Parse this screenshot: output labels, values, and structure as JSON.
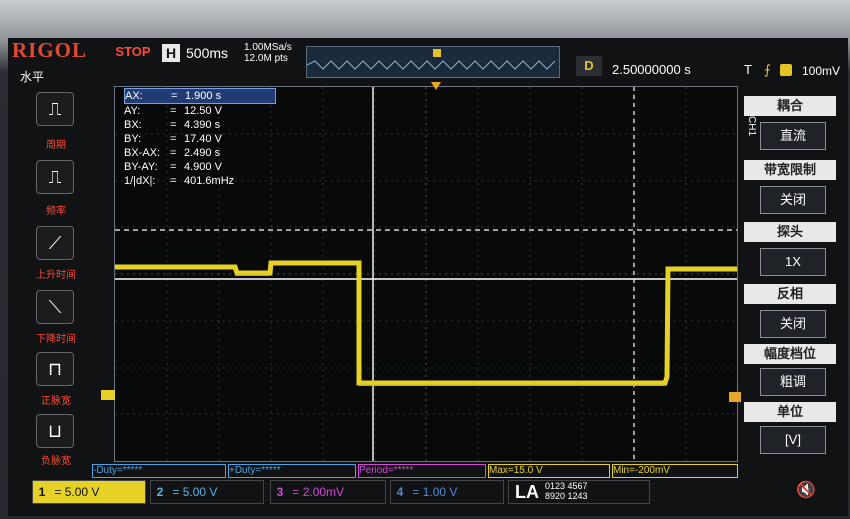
{
  "header": {
    "logo": "RIGOL",
    "run_state": "STOP",
    "timebase_label": "H",
    "timebase_value": "500ms",
    "sample_rate": "1.00MSa/s",
    "memory_depth": "12.0M pts",
    "delay_label": "D",
    "delay_value": "2.50000000 s",
    "trigger_label": "T",
    "trigger_level": "100mV"
  },
  "left_menu": {
    "title": "水平",
    "items": [
      {
        "label": "周期",
        "icon": "period-icon"
      },
      {
        "label": "频率",
        "icon": "frequency-icon"
      },
      {
        "label": "上升时间",
        "icon": "rise-time-icon"
      },
      {
        "label": "下降时间",
        "icon": "fall-time-icon"
      },
      {
        "label": "正脉宽",
        "icon": "positive-width-icon"
      },
      {
        "label": "负脉宽",
        "icon": "negative-width-icon"
      }
    ]
  },
  "cursor": {
    "rows": [
      {
        "key": "AX:",
        "eq": "=",
        "val": "1.900 s"
      },
      {
        "key": "AY:",
        "eq": "=",
        "val": "12.50 V"
      },
      {
        "key": "BX:",
        "eq": "=",
        "val": "4.390 s"
      },
      {
        "key": "BY:",
        "eq": "=",
        "val": "17.40 V"
      },
      {
        "key": "BX-AX:",
        "eq": "=",
        "val": "2.490 s"
      },
      {
        "key": "BY-AY:",
        "eq": "=",
        "val": "4.900 V"
      },
      {
        "key": "1/|dX|:",
        "eq": "=",
        "val": "401.6mHz"
      }
    ]
  },
  "right_menu": {
    "channel": "CH1",
    "items": [
      {
        "title": "耦合",
        "value": "直流"
      },
      {
        "title": "带宽限制",
        "value": "关闭"
      },
      {
        "title": "探头",
        "value": "1X"
      },
      {
        "title": "反相",
        "value": "关闭"
      },
      {
        "title": "幅度档位",
        "value": "粗调"
      },
      {
        "title": "单位",
        "value": "[V]"
      }
    ]
  },
  "measurements": [
    {
      "label": "-Duty=*****",
      "color": "#4fa3e0"
    },
    {
      "label": "+Duty=*****",
      "color": "#4fa3e0"
    },
    {
      "label": "Period=*****",
      "color": "#d04bd6"
    },
    {
      "label": "Max=15.0 V",
      "color": "#e6d126"
    },
    {
      "label": "Min=-200mV",
      "color": "#e6d126"
    }
  ],
  "channels": [
    {
      "num": "1",
      "scale": "5.00 V",
      "color": "#e6d126"
    },
    {
      "num": "2",
      "scale": "5.00 V",
      "color": "#5ab4e8"
    },
    {
      "num": "3",
      "scale": "2.00mV",
      "color": "#d04bd6"
    },
    {
      "num": "4",
      "scale": "1.00 V",
      "color": "#4f8bd9"
    }
  ],
  "la": {
    "label": "LA",
    "digits_top": "0123 4567",
    "digits_bottom": "8920 1243"
  }
}
